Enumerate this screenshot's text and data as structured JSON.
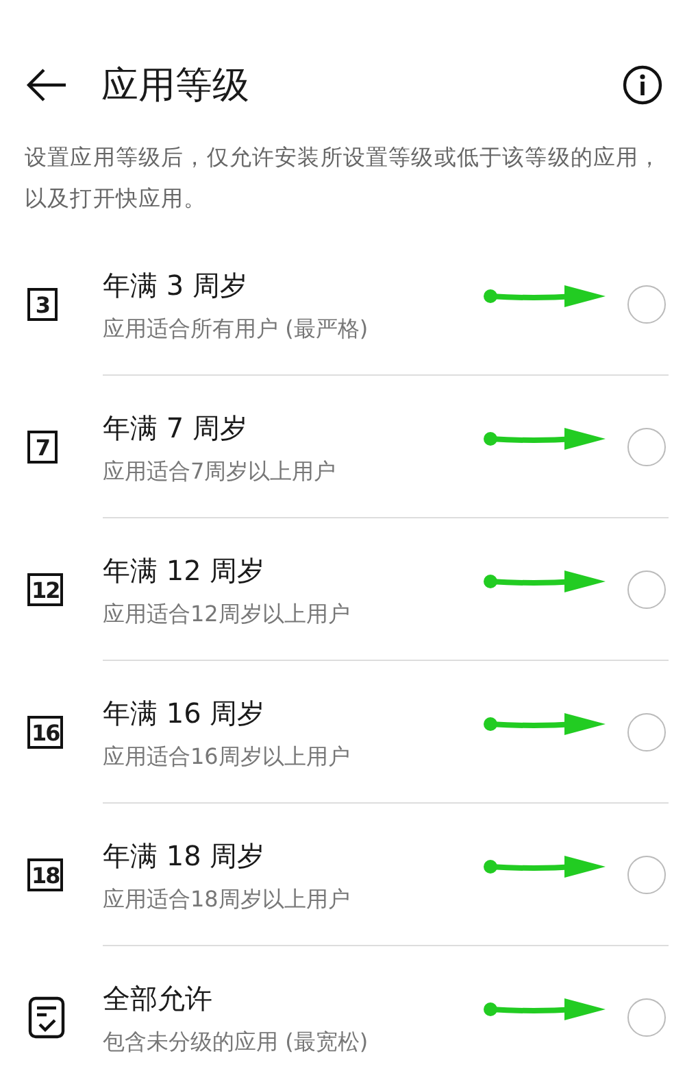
{
  "header": {
    "title": "应用等级"
  },
  "description": "设置应用等级后，仅允许安装所设置等级或低于该等级的应用，以及打开快应用。",
  "levels": [
    {
      "kind": "rating",
      "badge": "3",
      "title": "年满 3 周岁",
      "subtitle": "应用适合所有用户 (最严格)",
      "selected": false
    },
    {
      "kind": "rating",
      "badge": "7",
      "title": "年满 7 周岁",
      "subtitle": "应用适合7周岁以上用户",
      "selected": false
    },
    {
      "kind": "rating",
      "badge": "12",
      "title": "年满 12 周岁",
      "subtitle": "应用适合12周岁以上用户",
      "selected": false
    },
    {
      "kind": "rating",
      "badge": "16",
      "title": "年满 16 周岁",
      "subtitle": "应用适合16周岁以上用户",
      "selected": false
    },
    {
      "kind": "rating",
      "badge": "18",
      "title": "年满 18 周岁",
      "subtitle": "应用适合18周岁以上用户",
      "selected": false
    },
    {
      "kind": "all",
      "title": "全部允许",
      "subtitle": "包含未分级的应用 (最宽松)",
      "selected": false
    }
  ]
}
